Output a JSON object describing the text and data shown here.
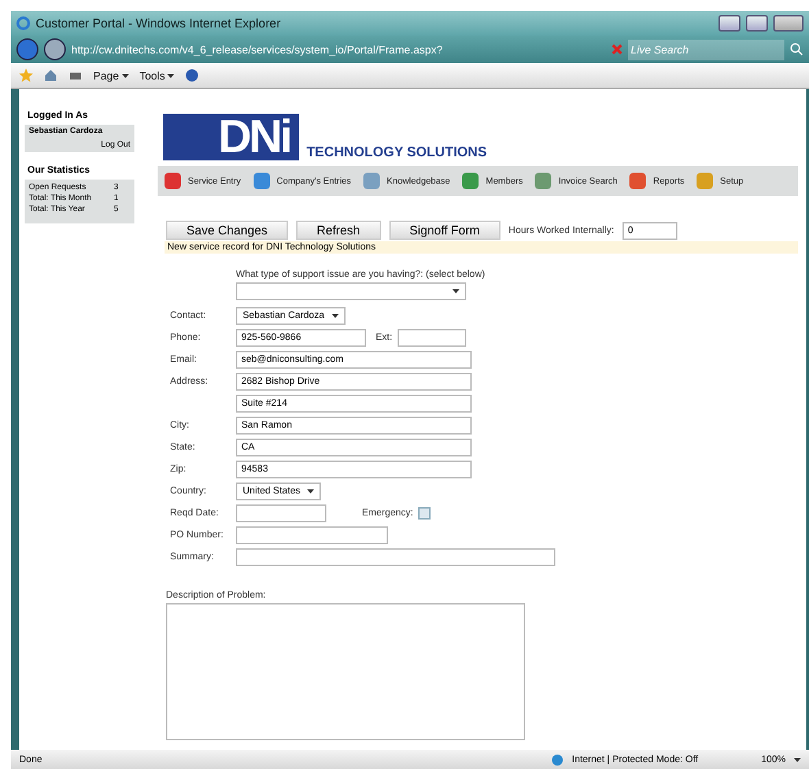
{
  "window": {
    "title": "Customer Portal - Windows Internet Explorer"
  },
  "address_bar": {
    "url": "http://cw.dnitechs.com/v4_6_release/services/system_io/Portal/Frame.aspx?",
    "search_placeholder": "Live Search"
  },
  "command_bar": [
    {
      "label": "Page"
    },
    {
      "label": "Tools"
    }
  ],
  "sidebar": {
    "logged_in": {
      "title": "Logged In As",
      "user": "Sebastian Cardoza",
      "logout": "Log Out"
    },
    "statistics": {
      "title": "Our Statistics",
      "rows": [
        {
          "label": "Open Requests",
          "value": "3"
        },
        {
          "label": "Total: This Month",
          "value": "1"
        },
        {
          "label": "Total: This Year",
          "value": "5"
        }
      ]
    }
  },
  "logo": {
    "mark": "DNi",
    "tagline": "TECHNOLOGY SOLUTIONS"
  },
  "nav": [
    {
      "label": "Service Entry"
    },
    {
      "label": "Company's Entries"
    },
    {
      "label": "Knowledgebase"
    },
    {
      "label": "Members"
    },
    {
      "label": "Invoice Search"
    },
    {
      "label": "Reports"
    },
    {
      "label": "Setup"
    }
  ],
  "actions": [
    "Save Changes",
    "Refresh",
    "Signoff Form"
  ],
  "hours": {
    "label": "Hours Worked Internally:",
    "value": "0"
  },
  "banner": "New service record for DNI Technology Solutions",
  "question": {
    "label": "What type of support issue are you having?: (select below)"
  },
  "form": [
    {
      "label": "Contact:",
      "kind": "select",
      "value": "Sebastian Cardoza"
    },
    {
      "label": "Phone:",
      "kind": "text",
      "value": "925-560-9866",
      "extra": {
        "label": "Ext:",
        "kind": "text"
      }
    },
    {
      "label": "Email:",
      "kind": "text",
      "value": "seb@dniconsulting.com"
    },
    {
      "label": "Address:",
      "kind": "text",
      "value": "2682 Bishop Drive"
    },
    {
      "kind": "text",
      "value": "Suite #214"
    },
    {
      "label": "City:",
      "kind": "text",
      "value": "San Ramon"
    },
    {
      "label": "State:",
      "kind": "text",
      "value": "CA"
    },
    {
      "label": "Zip:",
      "kind": "text",
      "value": "94583"
    },
    {
      "label": "Country:",
      "kind": "select",
      "value": "United States"
    },
    {
      "label": "Reqd Date:",
      "kind": "text",
      "extra": {
        "label": "Emergency:",
        "kind": "checkbox",
        "checked": false
      }
    },
    {
      "label": "PO Number:",
      "kind": "text"
    },
    {
      "label": "Summary:",
      "kind": "text"
    }
  ],
  "description": {
    "label": "Description of Problem:"
  },
  "status_bar": {
    "text": "Done",
    "zone": "Internet | Protected Mode: Off",
    "zoom": "100%"
  }
}
